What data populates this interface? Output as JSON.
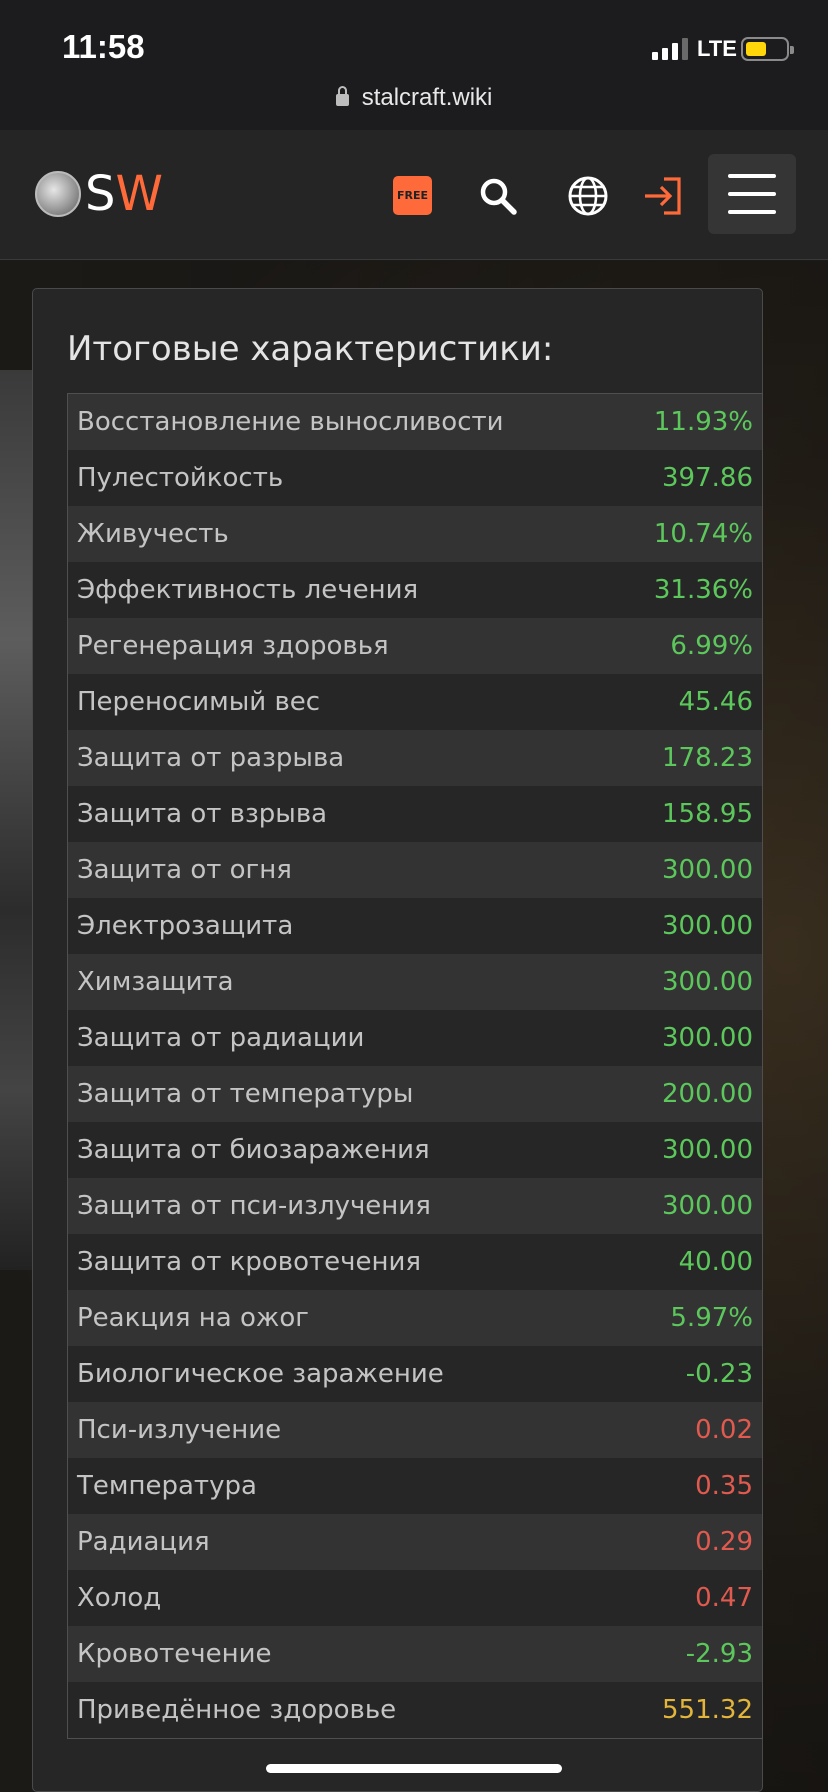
{
  "status_bar": {
    "time": "11:58",
    "network": "LTE"
  },
  "browser": {
    "url": "stalcraft.wiki"
  },
  "header": {
    "logo_s": "S",
    "logo_w": "W",
    "free_label": "FREE",
    "icons": [
      "search-icon",
      "globe-icon",
      "login-icon",
      "menu-icon"
    ]
  },
  "colors": {
    "positive": "#5cc85c",
    "negative": "#e05a4f",
    "highlight": "#e3b53a",
    "accent": "#ff6a3a"
  },
  "panel": {
    "title": "Итоговые характеристики:",
    "stats": [
      {
        "label": "Восстановление выносливости",
        "value": "11.93%",
        "tone": "positive"
      },
      {
        "label": "Пулестойкость",
        "value": "397.86",
        "tone": "positive"
      },
      {
        "label": "Живучесть",
        "value": "10.74%",
        "tone": "positive"
      },
      {
        "label": "Эффективность лечения",
        "value": "31.36%",
        "tone": "positive"
      },
      {
        "label": "Регенерация здоровья",
        "value": "6.99%",
        "tone": "positive"
      },
      {
        "label": "Переносимый вес",
        "value": "45.46",
        "tone": "positive"
      },
      {
        "label": "Защита от разрыва",
        "value": "178.23",
        "tone": "positive"
      },
      {
        "label": "Защита от взрыва",
        "value": "158.95",
        "tone": "positive"
      },
      {
        "label": "Защита от огня",
        "value": "300.00",
        "tone": "positive"
      },
      {
        "label": "Электрозащита",
        "value": "300.00",
        "tone": "positive"
      },
      {
        "label": "Химзащита",
        "value": "300.00",
        "tone": "positive"
      },
      {
        "label": "Защита от радиации",
        "value": "300.00",
        "tone": "positive"
      },
      {
        "label": "Защита от температуры",
        "value": "200.00",
        "tone": "positive"
      },
      {
        "label": "Защита от биозаражения",
        "value": "300.00",
        "tone": "positive"
      },
      {
        "label": "Защита от пси-излучения",
        "value": "300.00",
        "tone": "positive"
      },
      {
        "label": "Защита от кровотечения",
        "value": "40.00",
        "tone": "positive"
      },
      {
        "label": "Реакция на ожог",
        "value": "5.97%",
        "tone": "positive"
      },
      {
        "label": "Биологическое заражение",
        "value": "-0.23",
        "tone": "positive"
      },
      {
        "label": "Пси-излучение",
        "value": "0.02",
        "tone": "negative"
      },
      {
        "label": "Температура",
        "value": "0.35",
        "tone": "negative"
      },
      {
        "label": "Радиация",
        "value": "0.29",
        "tone": "negative"
      },
      {
        "label": "Холод",
        "value": "0.47",
        "tone": "negative"
      },
      {
        "label": "Кровотечение",
        "value": "-2.93",
        "tone": "positive"
      },
      {
        "label": "Приведённое здоровье",
        "value": "551.32",
        "tone": "highlight"
      }
    ]
  }
}
